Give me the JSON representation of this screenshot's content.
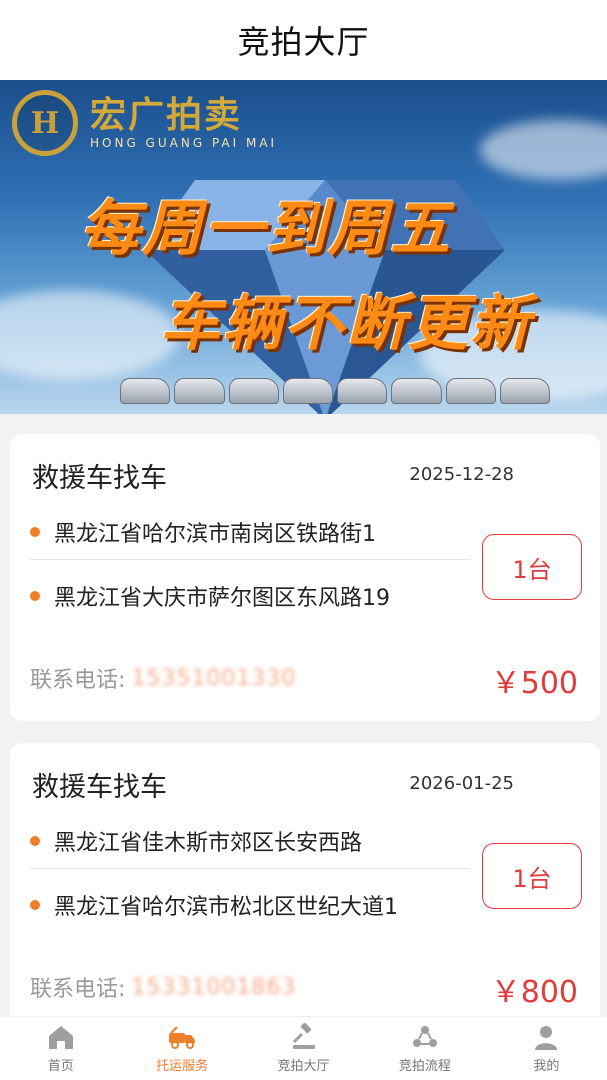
{
  "header": {
    "title": "竞拍大厅"
  },
  "banner": {
    "brand_cn": "宏广拍卖",
    "brand_en": "HONG GUANG PAI MAI",
    "slogan_line1": "每周一到周五",
    "slogan_line2": "车辆不断更新"
  },
  "orders": [
    {
      "title": "救援车找车",
      "date": "2025-12-28",
      "from": "黑龙江省哈尔滨市南岗区铁路街1",
      "to": "黑龙江省大庆市萨尔图区东风路19",
      "quantity": "1台",
      "phone_label": "联系电话:",
      "phone_value": "15351001330",
      "price": "￥500"
    },
    {
      "title": "救援车找车",
      "date": "2026-01-25",
      "from": "黑龙江省佳木斯市郊区长安西路",
      "to": "黑龙江省哈尔滨市松北区世纪大道1",
      "quantity": "1台",
      "phone_label": "联系电话:",
      "phone_value": "15331001863",
      "price": "￥800"
    }
  ],
  "tabbar": {
    "items": [
      {
        "label": "首页",
        "icon": "home-icon",
        "active": false
      },
      {
        "label": "托运服务",
        "icon": "tow-truck-icon",
        "active": true
      },
      {
        "label": "竞拍大厅",
        "icon": "gavel-icon",
        "active": false
      },
      {
        "label": "竞拍流程",
        "icon": "process-icon",
        "active": false
      },
      {
        "label": "我的",
        "icon": "user-icon",
        "active": false
      }
    ]
  },
  "colors": {
    "accent": "#f07d2a",
    "price": "#e23b3b"
  }
}
